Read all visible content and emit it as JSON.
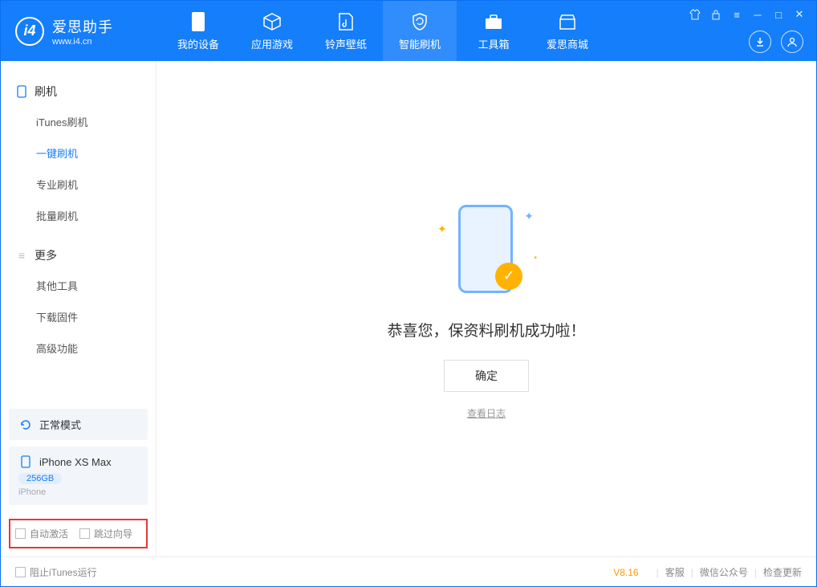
{
  "app": {
    "name": "爱思助手",
    "url": "www.i4.cn"
  },
  "tabs": [
    {
      "label": "我的设备"
    },
    {
      "label": "应用游戏"
    },
    {
      "label": "铃声壁纸"
    },
    {
      "label": "智能刷机"
    },
    {
      "label": "工具箱"
    },
    {
      "label": "爱思商城"
    }
  ],
  "sidebar": {
    "group1": {
      "title": "刷机",
      "items": [
        "iTunes刷机",
        "一键刷机",
        "专业刷机",
        "批量刷机"
      ]
    },
    "group2": {
      "title": "更多",
      "items": [
        "其他工具",
        "下载固件",
        "高级功能"
      ]
    }
  },
  "mode_card": {
    "label": "正常模式"
  },
  "device_card": {
    "name": "iPhone XS Max",
    "storage": "256GB",
    "type": "iPhone"
  },
  "options": {
    "auto_activate": "自动激活",
    "skip_guide": "跳过向导"
  },
  "main": {
    "message": "恭喜您，保资料刷机成功啦！",
    "ok": "确定",
    "view_log": "查看日志"
  },
  "footer": {
    "block_itunes": "阻止iTunes运行",
    "version": "V8.16",
    "links": [
      "客服",
      "微信公众号",
      "检查更新"
    ]
  }
}
